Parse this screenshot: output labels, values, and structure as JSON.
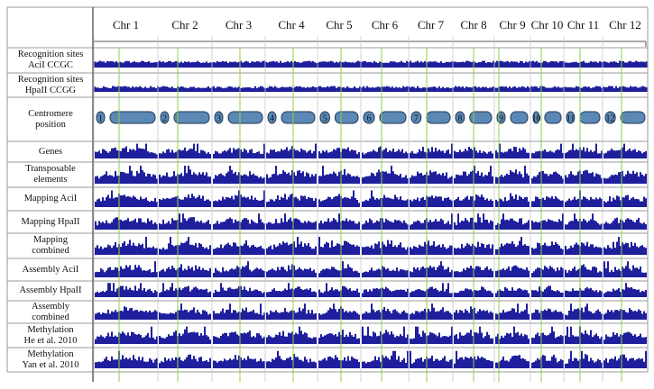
{
  "chromosomes": [
    "Chr 1",
    "Chr 2",
    "Chr 3",
    "Chr 4",
    "Chr 5",
    "Chr 6",
    "Chr 7",
    "Chr 8",
    "Chr 9",
    "Chr 10",
    "Chr 11",
    "Chr 12"
  ],
  "centromere_numbers": [
    "1",
    "2",
    "3",
    "4",
    "5",
    "6",
    "7",
    "8",
    "9",
    "10",
    "11",
    "12"
  ],
  "rows": [
    {
      "key": "acil_sites",
      "lines": [
        "Recognition sites",
        "AciI CCGC"
      ],
      "kind": "density-flat"
    },
    {
      "key": "hpaii_sites",
      "lines": [
        "Recognition sites",
        "HpaII CCGG"
      ],
      "kind": "density-flat"
    },
    {
      "key": "centromere",
      "lines": [
        "Centromere",
        "position"
      ],
      "kind": "centromere"
    },
    {
      "key": "genes",
      "lines": [
        "Genes"
      ],
      "kind": "histogram"
    },
    {
      "key": "transposable",
      "lines": [
        "Transposable",
        "elements"
      ],
      "kind": "histogram"
    },
    {
      "key": "mapping_acil",
      "lines": [
        "Mapping AciI"
      ],
      "kind": "histogram"
    },
    {
      "key": "mapping_hpaii",
      "lines": [
        "Mapping HpaII"
      ],
      "kind": "histogram"
    },
    {
      "key": "mapping_combined",
      "lines": [
        "Mapping",
        "combined"
      ],
      "kind": "histogram"
    },
    {
      "key": "assembly_acil",
      "lines": [
        "Assembly AciI"
      ],
      "kind": "histogram"
    },
    {
      "key": "assembly_hpaii",
      "lines": [
        "Assembly HpaII"
      ],
      "kind": "histogram"
    },
    {
      "key": "assembly_combined",
      "lines": [
        "Assembly",
        "combined"
      ],
      "kind": "histogram"
    },
    {
      "key": "methylation_he",
      "lines": [
        "Methylation",
        "He et al. 2010"
      ],
      "kind": "histogram"
    },
    {
      "key": "methylation_yan",
      "lines": [
        "Methylation",
        "Yan et al. 2010"
      ],
      "kind": "histogram"
    }
  ],
  "colors": {
    "bars": "#1f1f9e",
    "centromere_fill": "#5b88b5",
    "centromere_stroke": "#1f3a5a",
    "marker": "#8fd04a",
    "grid": "#9a9a9a"
  }
}
